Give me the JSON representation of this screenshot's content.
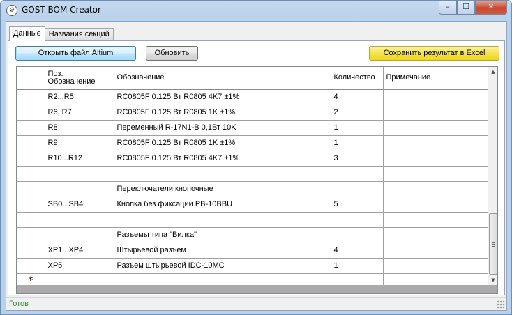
{
  "window": {
    "title": "GOST BOM Creator",
    "icon": "gear-app-icon",
    "minimize_glyph": "–",
    "maximize_glyph": "☐",
    "close_glyph": "✕"
  },
  "tabs": [
    {
      "label": "Данные",
      "active": true
    },
    {
      "label": "Названия секций",
      "active": false
    }
  ],
  "toolbar": {
    "open_label": "Открыть файл Altium",
    "refresh_label": "Обновить",
    "save_label": "Сохранить результат в Excel"
  },
  "grid": {
    "columns": [
      "Поз. Обозначение",
      "Обозначение",
      "Количество",
      "Примечание"
    ],
    "rows": [
      [
        "R2...R5",
        "RC0805F 0.125 Вт R0805 4K7 ±1%",
        "4",
        ""
      ],
      [
        "R6, R7",
        "RC0805F 0.125 Вт R0805 1K ±1%",
        "2",
        ""
      ],
      [
        "R8",
        "Переменный R-17N1-B  0,1Вт  10K",
        "1",
        ""
      ],
      [
        "R9",
        "RC0805F 0.125 Вт R0805 1K ±1%",
        "1",
        ""
      ],
      [
        "R10...R12",
        "RC0805F 0.125 Вт R0805 4K7 ±1%",
        "3",
        ""
      ],
      [
        "",
        "",
        "",
        ""
      ],
      [
        "",
        "Переключатели кнопочные",
        "",
        ""
      ],
      [
        "SB0...SB4",
        "Кнопка без фиксации PB-10BBU",
        "5",
        ""
      ],
      [
        "",
        "",
        "",
        ""
      ],
      [
        "",
        "Разъемы типа \"Вилка\"",
        "",
        ""
      ],
      [
        "XP1...XP4",
        "Штырьевой разъем",
        "4",
        ""
      ],
      [
        "XP5",
        "Разъем штырьевой IDC-10MC",
        "1",
        ""
      ]
    ],
    "new_row_marker": "*",
    "scroll_up_glyph": "▲",
    "scroll_down_glyph": "▼"
  },
  "status": {
    "text": "Готов",
    "color": "#2e8b2e"
  },
  "colors": {
    "save_button": "#f4e34a",
    "open_button_focus": "#bee6fd"
  }
}
